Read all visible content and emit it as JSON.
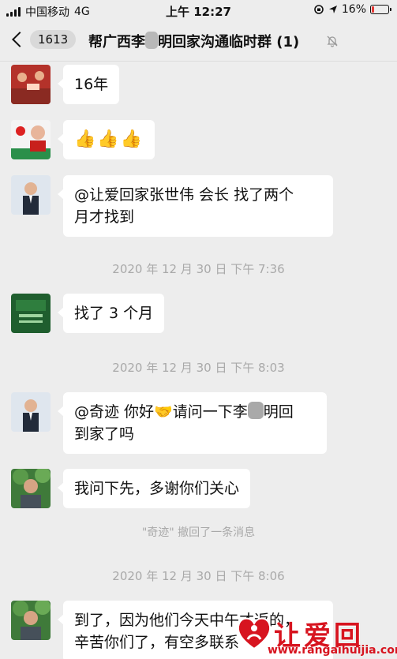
{
  "status_bar": {
    "carrier": "中国移动",
    "network": "4G",
    "time": "上午 12:27",
    "battery": "16%",
    "battery_level": 0.16
  },
  "nav": {
    "back_count": "1613",
    "title_prefix": "帮广西李",
    "title_suffix": "明回家沟通临时群",
    "member_count": "(1)"
  },
  "messages": [
    {
      "text": "16年",
      "avatar": "avatar-red-volunteers"
    },
    {
      "text": "👍👍👍",
      "avatar": "avatar-volunteer-logo"
    },
    {
      "text": "@让爱回家张世伟  会长 找了两个月才找到",
      "line1": "@让爱回家张世伟  会长 找了两个",
      "line2": "月才找到",
      "avatar": "avatar-man-suit"
    },
    {
      "text": "找了 3 个月",
      "avatar": "avatar-green-sign"
    },
    {
      "line1_prefix": "@奇迹 你好",
      "line1_emoji": "🤝",
      "line1_rest": "请问一下李",
      "line1_after": "明回",
      "line2": "到家了吗",
      "avatar": "avatar-man-suit"
    },
    {
      "text": "我问下先，多谢你们关心",
      "avatar": "avatar-man-tree"
    },
    {
      "line1": "到了，因为他们今天中午才返的，",
      "line2": "辛苦你们了，有空多联系",
      "avatar": "avatar-man-tree"
    }
  ],
  "timestamps": [
    "2020 年 12 月 30 日  下午 7:36",
    "2020 年 12 月 30 日  下午 8:03",
    "2020 年 12 月 30 日  下午 8:06"
  ],
  "system_notice": "\"奇迹\" 撤回了一条消息",
  "watermark": {
    "text": "让爱回家",
    "url": "www.rangaihuijia.com"
  },
  "colors": {
    "bg": "#ededed",
    "bubble": "#ffffff",
    "meta": "#a9a9a9",
    "brand_red": "#d7141f"
  }
}
